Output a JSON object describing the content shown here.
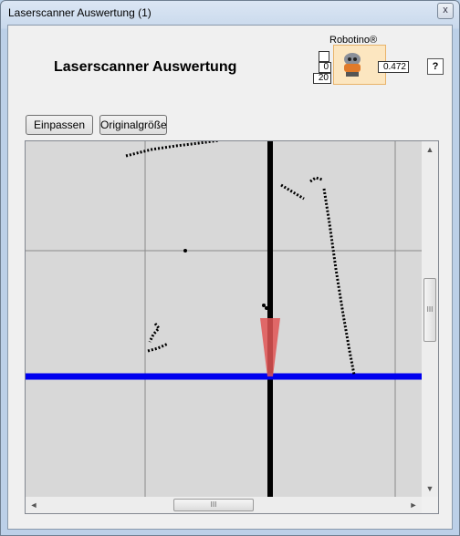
{
  "window": {
    "title": "Laserscanner Auswertung (1)",
    "close_label": "x"
  },
  "main": {
    "heading": "Laserscanner Auswertung"
  },
  "robotino": {
    "title": "Robotino®",
    "input_top": "0",
    "input_bottom": "20",
    "output_value": "0.472"
  },
  "help": {
    "label": "?"
  },
  "toolbar": {
    "fit_label": "Einpassen",
    "original_size_label": "Originalgröße"
  },
  "scrollbars": {
    "up": "▲",
    "down": "▼",
    "left": "◄",
    "right": "►",
    "grip": "III"
  },
  "colors": {
    "axis_x": "#0000ee",
    "axis_y": "#000000",
    "sensor_cone": "#e25555",
    "background": "#d8d8d8",
    "grid": "#8a8a8a"
  }
}
